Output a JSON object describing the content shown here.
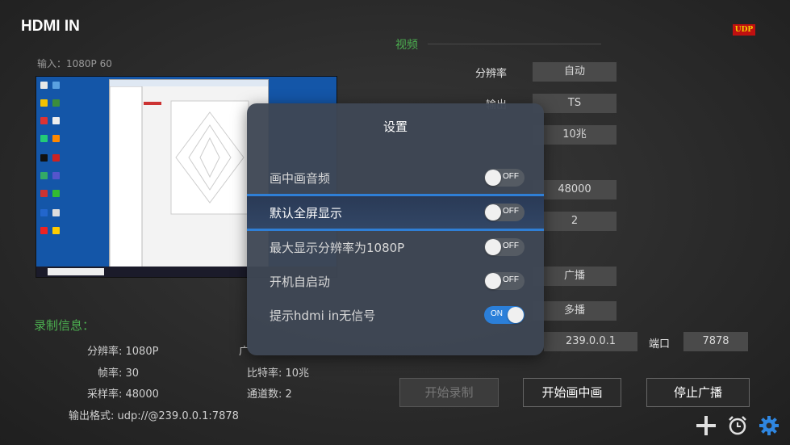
{
  "app": {
    "title": "HDMI IN",
    "input_info": "输入：1080P  60",
    "udp_badge": "UDP"
  },
  "video": {
    "section_label": "视频",
    "rows": [
      {
        "label": "分辨率",
        "value": "自动"
      },
      {
        "label": "输出",
        "value": "TS"
      },
      {
        "label": "",
        "value": "10兆"
      },
      {
        "label": "",
        "value": "48000"
      },
      {
        "label": "",
        "value": "2"
      },
      {
        "label": "",
        "value": "广播"
      },
      {
        "label": "",
        "value": "多播"
      }
    ],
    "address": "239.0.0.1",
    "port_label": "端口",
    "port": "7878"
  },
  "record_info": {
    "title": "录制信息：",
    "resolution": "分辨率: 1080P",
    "framerate": "帧率: 30",
    "samplerate": "采样率: 48000",
    "output_format": "输出格式: udp://@239.0.0.1:7878",
    "broadcast_partial": "广",
    "bitrate": "比特率: 10兆",
    "channels": "通道数: 2"
  },
  "buttons": {
    "start_record": "开始录制",
    "start_pip": "开始画中画",
    "stop_broadcast": "停止广播"
  },
  "icons": {
    "add": "plus-icon",
    "alarm": "alarm-clock-icon",
    "settings": "gear-icon"
  },
  "settings_modal": {
    "title": "设置",
    "options": [
      {
        "label": "画中画音频",
        "state": "OFF"
      },
      {
        "label": "默认全屏显示",
        "state": "OFF"
      },
      {
        "label": "最大显示分辨率为1080P",
        "state": "OFF"
      },
      {
        "label": "开机自启动",
        "state": "OFF"
      },
      {
        "label": "提示hdmi in无信号",
        "state": "ON"
      }
    ]
  },
  "colors": {
    "accent_green": "#4caf50",
    "toggle_on": "#2b7fd9",
    "highlight_border": "#2f7fd6",
    "gear": "#2f86e0"
  }
}
